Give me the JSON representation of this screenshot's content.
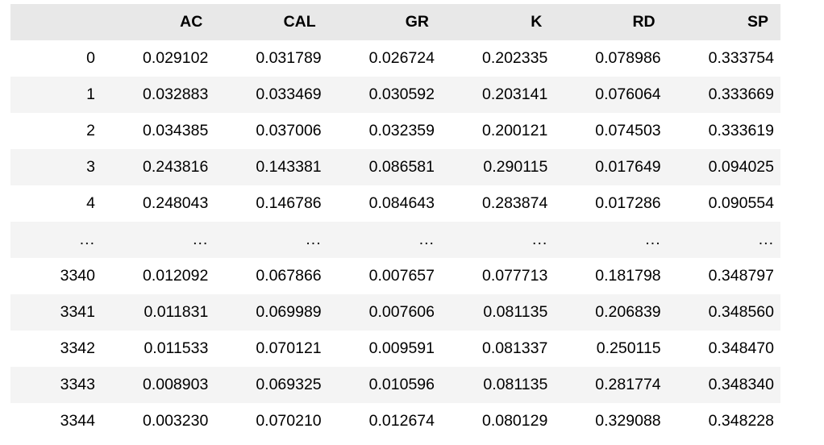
{
  "table": {
    "index_header": "",
    "columns": [
      "AC",
      "CAL",
      "GR",
      "K",
      "RD",
      "SP"
    ],
    "rows": [
      {
        "index": "0",
        "values": [
          "0.029102",
          "0.031789",
          "0.026724",
          "0.202335",
          "0.078986",
          "0.333754"
        ]
      },
      {
        "index": "1",
        "values": [
          "0.032883",
          "0.033469",
          "0.030592",
          "0.203141",
          "0.076064",
          "0.333669"
        ]
      },
      {
        "index": "2",
        "values": [
          "0.034385",
          "0.037006",
          "0.032359",
          "0.200121",
          "0.074503",
          "0.333619"
        ]
      },
      {
        "index": "3",
        "values": [
          "0.243816",
          "0.143381",
          "0.086581",
          "0.290115",
          "0.017649",
          "0.094025"
        ]
      },
      {
        "index": "4",
        "values": [
          "0.248043",
          "0.146786",
          "0.084643",
          "0.283874",
          "0.017286",
          "0.090554"
        ]
      },
      {
        "index": "...",
        "values": [
          "...",
          "...",
          "...",
          "...",
          "...",
          "..."
        ]
      },
      {
        "index": "3340",
        "values": [
          "0.012092",
          "0.067866",
          "0.007657",
          "0.077713",
          "0.181798",
          "0.348797"
        ]
      },
      {
        "index": "3341",
        "values": [
          "0.011831",
          "0.069989",
          "0.007606",
          "0.081135",
          "0.206839",
          "0.348560"
        ]
      },
      {
        "index": "3342",
        "values": [
          "0.011533",
          "0.070121",
          "0.009591",
          "0.081337",
          "0.250115",
          "0.348470"
        ]
      },
      {
        "index": "3343",
        "values": [
          "0.008903",
          "0.069325",
          "0.010596",
          "0.081135",
          "0.281774",
          "0.348340"
        ]
      },
      {
        "index": "3344",
        "values": [
          "0.003230",
          "0.070210",
          "0.012674",
          "0.080129",
          "0.329088",
          "0.348228"
        ]
      }
    ]
  },
  "colors": {
    "header_background": "#e8e8e8",
    "odd_row_background": "#f4f4f4",
    "even_row_background": "#ffffff",
    "text": "#000000"
  },
  "chart_data": {
    "type": "table",
    "title": "",
    "columns": [
      "AC",
      "CAL",
      "GR",
      "K",
      "RD",
      "SP"
    ],
    "index": [
      "0",
      "1",
      "2",
      "3",
      "4",
      "...",
      "3340",
      "3341",
      "3342",
      "3343",
      "3344"
    ],
    "series": [
      {
        "name": "AC",
        "values": [
          0.029102,
          0.032883,
          0.034385,
          0.243816,
          0.248043,
          null,
          0.012092,
          0.011831,
          0.011533,
          0.008903,
          0.00323
        ]
      },
      {
        "name": "CAL",
        "values": [
          0.031789,
          0.033469,
          0.037006,
          0.143381,
          0.146786,
          null,
          0.067866,
          0.069989,
          0.070121,
          0.069325,
          0.07021
        ]
      },
      {
        "name": "GR",
        "values": [
          0.026724,
          0.030592,
          0.032359,
          0.086581,
          0.084643,
          null,
          0.007657,
          0.007606,
          0.009591,
          0.010596,
          0.012674
        ]
      },
      {
        "name": "K",
        "values": [
          0.202335,
          0.203141,
          0.200121,
          0.290115,
          0.283874,
          null,
          0.077713,
          0.081135,
          0.081337,
          0.081135,
          0.080129
        ]
      },
      {
        "name": "RD",
        "values": [
          0.078986,
          0.076064,
          0.074503,
          0.017649,
          0.017286,
          null,
          0.181798,
          0.206839,
          0.250115,
          0.281774,
          0.329088
        ]
      },
      {
        "name": "SP",
        "values": [
          0.333754,
          0.333669,
          0.333619,
          0.094025,
          0.090554,
          null,
          0.348797,
          0.34856,
          0.34847,
          0.34834,
          0.348228
        ]
      }
    ]
  }
}
